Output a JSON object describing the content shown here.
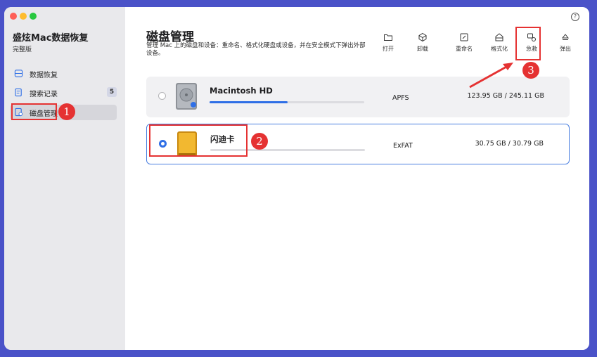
{
  "sidebar": {
    "app_title": "盛炫Mac数据恢复",
    "edition": "完整版",
    "items": [
      {
        "label": "数据恢复",
        "icon": "data-recovery-icon"
      },
      {
        "label": "搜索记录",
        "icon": "search-history-icon",
        "badge": "5"
      },
      {
        "label": "磁盘管理",
        "icon": "disk-management-icon"
      }
    ]
  },
  "main": {
    "title": "磁盘管理",
    "description": "管理 Mac 上的磁盘和设备：重命名、格式化硬盘或设备，并在安全模式下弹出外部设备。",
    "toolbar": [
      {
        "label": "打开",
        "icon": "folder-icon"
      },
      {
        "label": "卸载",
        "icon": "unmount-icon"
      },
      {
        "label": "重命名",
        "icon": "rename-icon"
      },
      {
        "label": "格式化",
        "icon": "format-icon"
      },
      {
        "label": "急救",
        "icon": "first-aid-icon"
      },
      {
        "label": "弹出",
        "icon": "eject-icon"
      }
    ],
    "disks": [
      {
        "name": "Macintosh HD",
        "filesystem": "APFS",
        "capacity": "123.95 GB / 245.11 GB",
        "usage": 0.506,
        "selected": false
      },
      {
        "name": "闪迪卡",
        "filesystem": "ExFAT",
        "capacity": "30.75 GB / 30.79 GB",
        "usage": 0.0,
        "selected": true
      }
    ]
  },
  "annotations": {
    "n1": "1",
    "n2": "2",
    "n3": "3"
  },
  "help_label": "?",
  "colors": {
    "accent": "#2f6fe6",
    "annotation": "#e53232",
    "background": "#4a52c8"
  }
}
